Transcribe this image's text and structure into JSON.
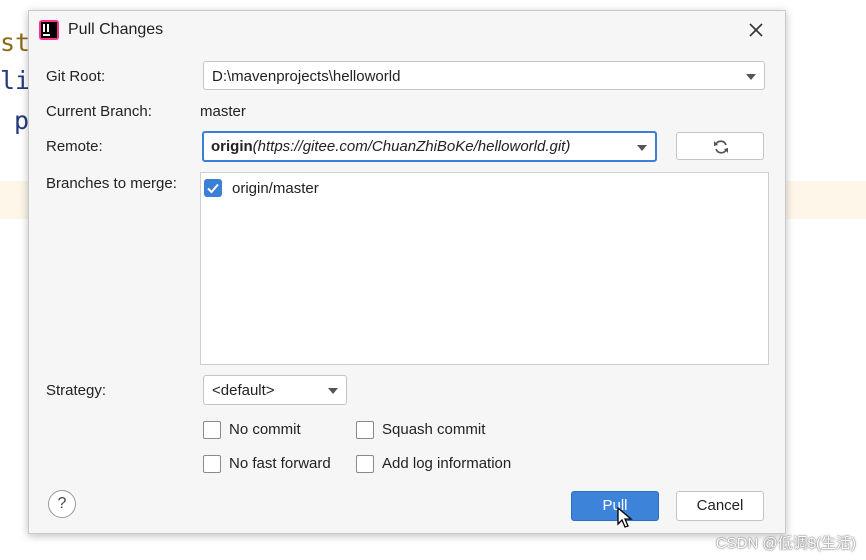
{
  "background": {
    "line1": "st",
    "line2": "li",
    "line3": "p"
  },
  "dialog": {
    "title": "Pull Changes",
    "git_root": {
      "label": "Git Root:",
      "value": "D:\\mavenprojects\\helloworld"
    },
    "current_branch": {
      "label": "Current Branch:",
      "value": "master"
    },
    "remote": {
      "label": "Remote:",
      "name": "origin",
      "url": "(https://gitee.com/ChuanZhiBoKe/helloworld.git)"
    },
    "branches": {
      "label": "Branches to merge:",
      "items": [
        {
          "label": "origin/master",
          "checked": true
        }
      ]
    },
    "strategy": {
      "label": "Strategy:",
      "value": "<default>"
    },
    "options": {
      "no_commit": "No commit",
      "squash_commit": "Squash commit",
      "no_fast_forward": "No fast forward",
      "add_log_information": "Add log information"
    },
    "buttons": {
      "help": "?",
      "pull": "Pull",
      "cancel": "Cancel"
    }
  },
  "watermark": "CSDN @低调$(生活)",
  "colors": {
    "accent": "#3d83d9",
    "dialog_bg": "#f6f6f6"
  },
  "icons": {
    "app": "intellij-icon",
    "close": "close-icon",
    "refresh": "refresh-icon",
    "cursor": "mouse-pointer-icon"
  }
}
